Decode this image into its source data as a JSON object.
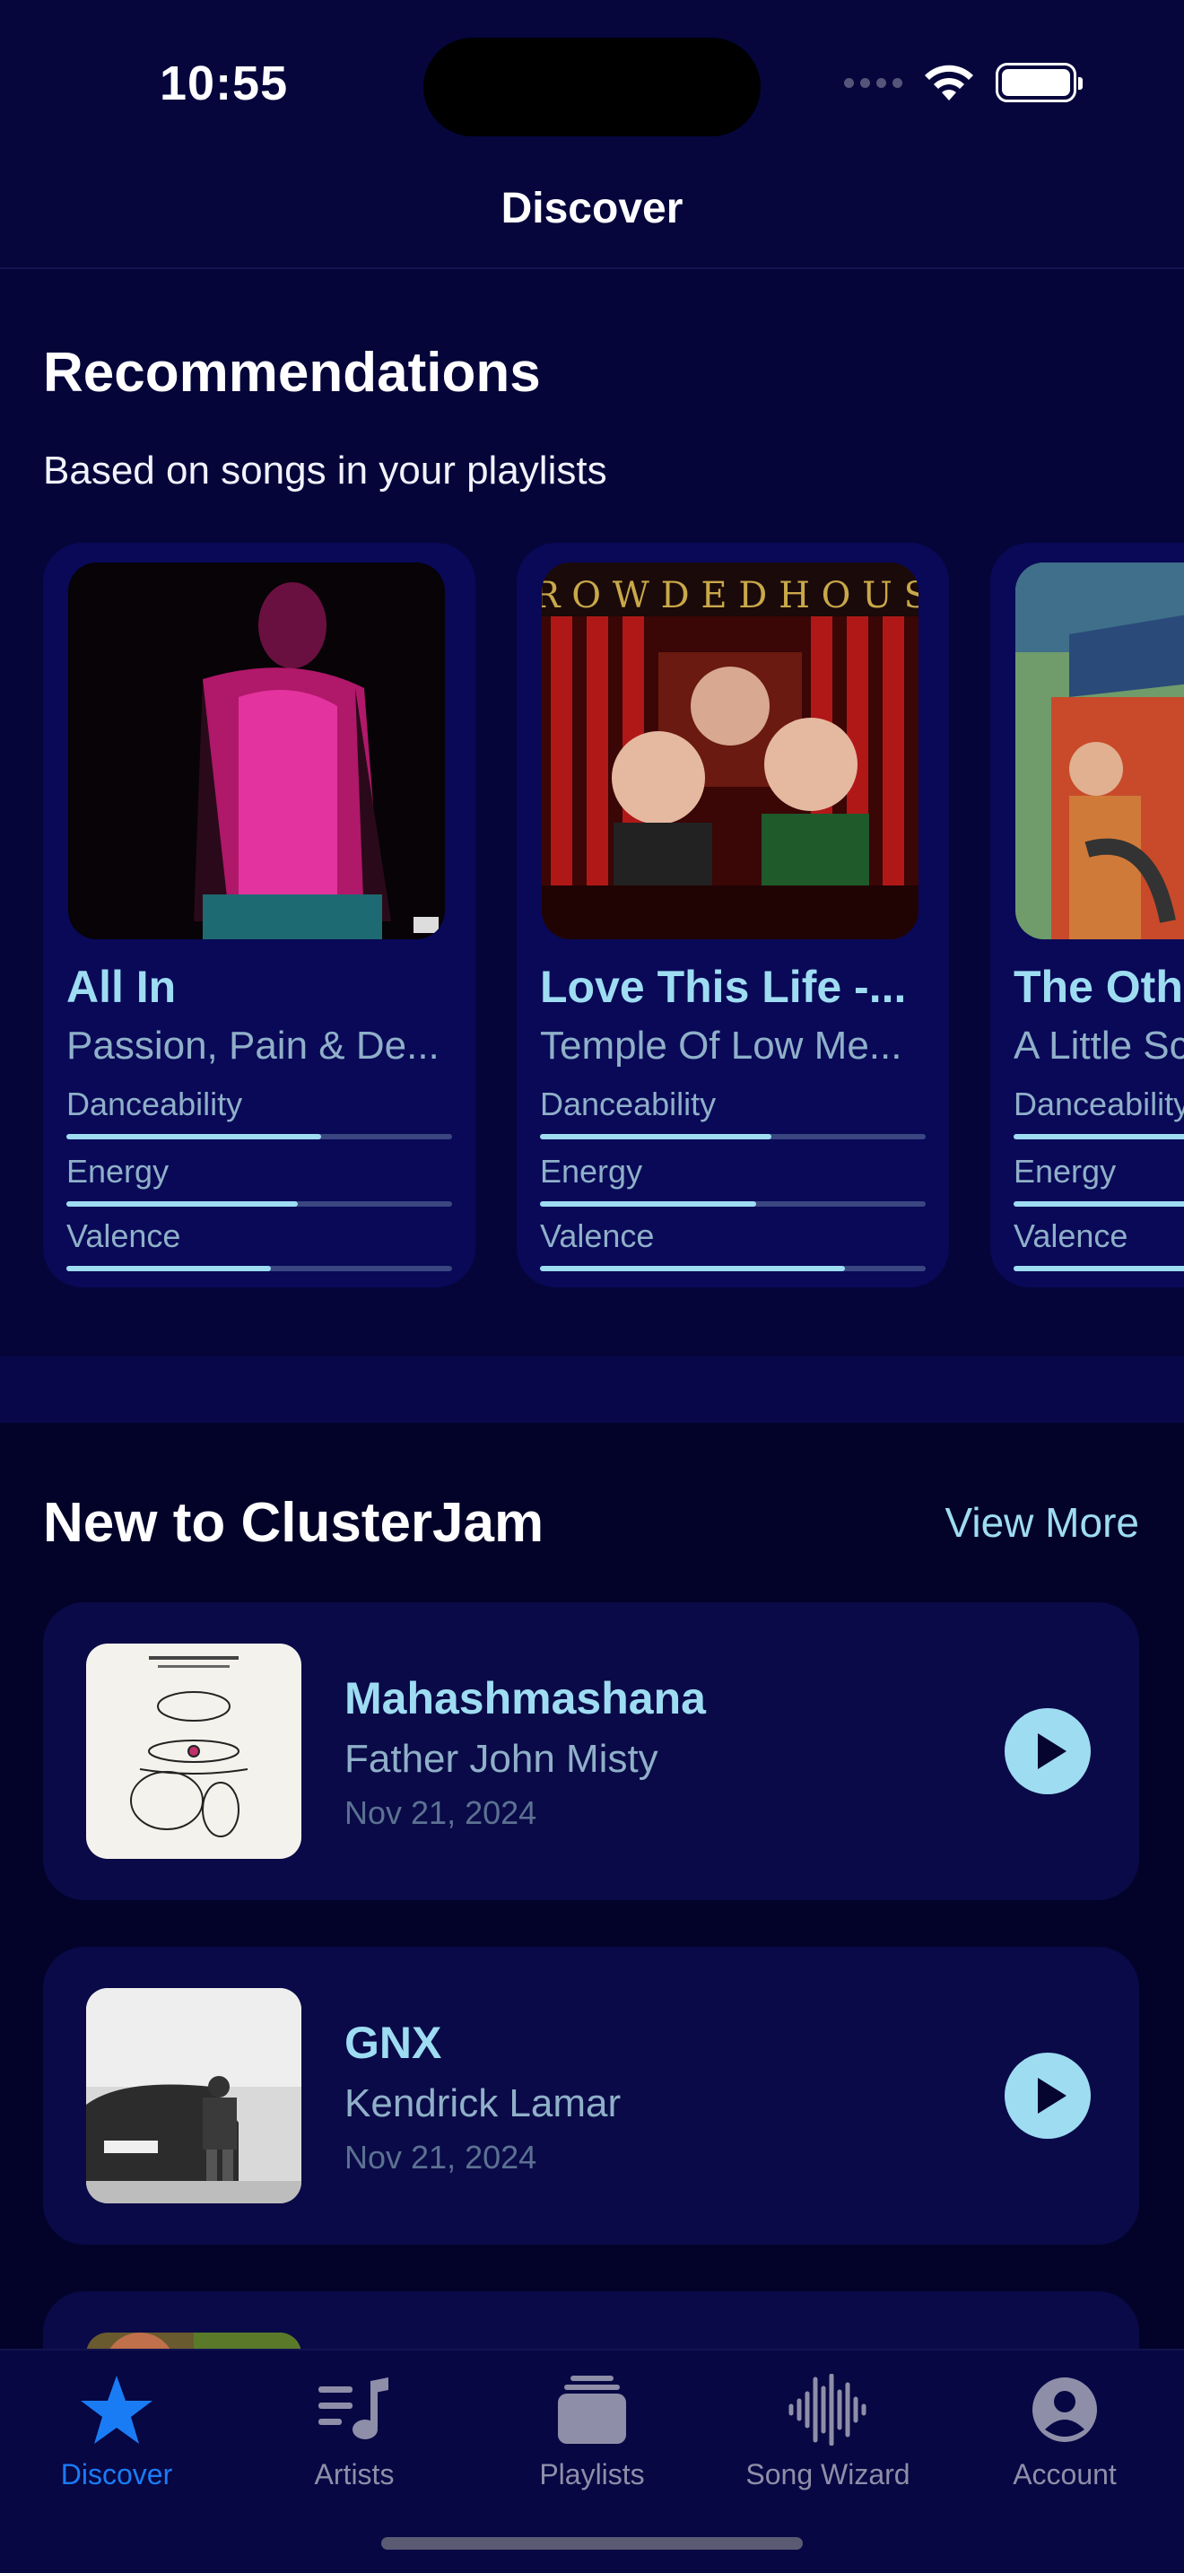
{
  "status_bar": {
    "time": "10:55"
  },
  "nav": {
    "title": "Discover"
  },
  "recommendations": {
    "title": "Recommendations",
    "subtitle": "Based on songs in your playlists",
    "cards": [
      {
        "title": "All In",
        "artist": "Passion, Pain & De...",
        "danceability": 0.66,
        "energy": 0.6,
        "valence": 0.53
      },
      {
        "title": "Love This Life -...",
        "artist": "Temple Of Low Me...",
        "danceability": 0.6,
        "energy": 0.56,
        "valence": 0.79
      },
      {
        "title": "The Oth",
        "artist": "A Little Sc",
        "danceability": 0.7,
        "energy": 0.7,
        "valence": 0.7
      }
    ],
    "metric_labels": {
      "danceability": "Danceability",
      "energy": "Energy",
      "valence": "Valence"
    }
  },
  "new_section": {
    "title": "New to ClusterJam",
    "view_more": "View More",
    "items": [
      {
        "title": "Mahashmashana",
        "artist": "Father John Misty",
        "date": "Nov 21, 2024"
      },
      {
        "title": "GNX",
        "artist": "Kendrick Lamar",
        "date": "Nov 21, 2024"
      }
    ]
  },
  "tabbar": {
    "tabs": [
      {
        "label": "Discover",
        "icon": "star-icon",
        "active": true
      },
      {
        "label": "Artists",
        "icon": "music-note-list-icon",
        "active": false
      },
      {
        "label": "Playlists",
        "icon": "stack-icon",
        "active": false
      },
      {
        "label": "Song Wizard",
        "icon": "waveform-icon",
        "active": false
      },
      {
        "label": "Account",
        "icon": "person-circle-icon",
        "active": false
      }
    ]
  },
  "colors": {
    "accent": "#9edcf2",
    "active_tab": "#1a7cf5",
    "background": "#050530"
  }
}
